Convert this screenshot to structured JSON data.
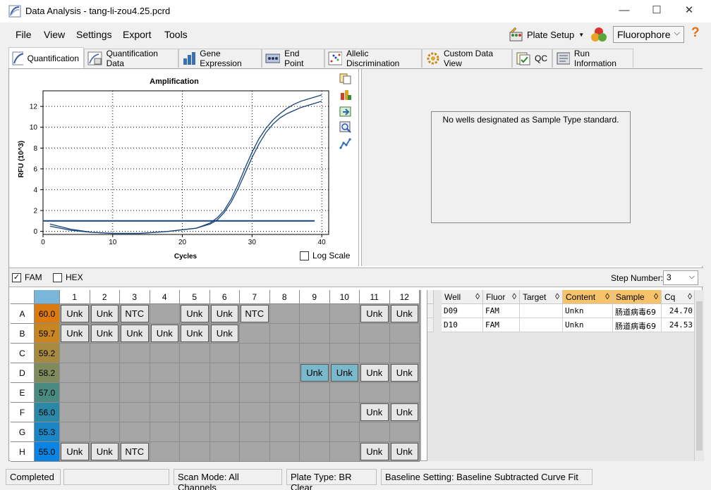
{
  "window": {
    "title": "Data Analysis - tang-li-zou4.25.pcrd",
    "minimize": "—",
    "maximize": "☐",
    "close": "✕"
  },
  "menu": [
    "File",
    "View",
    "Settings",
    "Export",
    "Tools"
  ],
  "toolbar": {
    "plate_setup": "Plate Setup",
    "fluorophore": "Fluorophore",
    "help": "?"
  },
  "tabs": [
    "Quantification",
    "Quantification Data",
    "Gene Expression",
    "End Point",
    "Allelic Discrimination",
    "Custom Data View",
    "QC",
    "Run Information"
  ],
  "chart_data": {
    "type": "line",
    "title": "Amplification",
    "xlabel": "Cycles",
    "ylabel": "RFU (10^3)",
    "xlim": [
      0,
      41
    ],
    "ylim": [
      -0.3,
      13.5
    ],
    "xticks": [
      0,
      10,
      20,
      30,
      40
    ],
    "yticks": [
      0,
      2,
      4,
      6,
      8,
      10,
      12
    ],
    "grid": true,
    "threshold": 1.0,
    "series": [
      {
        "x": [
          1,
          4,
          7,
          10,
          14,
          18,
          22,
          24,
          25,
          26,
          27,
          28,
          29,
          30,
          31,
          32,
          33,
          34,
          35,
          36,
          37,
          38,
          39,
          40
        ],
        "values": [
          0.5,
          0.1,
          -0.1,
          -0.2,
          -0.2,
          0.0,
          0.3,
          0.7,
          1.1,
          1.8,
          2.8,
          4.1,
          5.6,
          7.1,
          8.4,
          9.5,
          10.3,
          10.9,
          11.3,
          11.6,
          11.9,
          12.1,
          12.3,
          12.5
        ]
      },
      {
        "x": [
          1,
          4,
          7,
          10,
          14,
          18,
          22,
          24,
          25,
          26,
          27,
          28,
          29,
          30,
          31,
          32,
          33,
          34,
          35,
          36,
          37,
          38,
          39,
          40
        ],
        "values": [
          0.7,
          0.2,
          -0.1,
          -0.2,
          -0.2,
          0.0,
          0.3,
          0.8,
          1.3,
          2.0,
          3.1,
          4.5,
          6.1,
          7.6,
          8.9,
          9.9,
          10.7,
          11.3,
          11.8,
          12.2,
          12.5,
          12.7,
          12.9,
          13.1
        ]
      }
    ]
  },
  "log_scale": "Log Scale",
  "no_standard": "No wells designated as Sample Type standard.",
  "fluors": [
    "FAM",
    "HEX"
  ],
  "step": {
    "label": "Step Number:",
    "value": "3"
  },
  "plate": {
    "cols": [
      "1",
      "2",
      "3",
      "4",
      "5",
      "6",
      "7",
      "8",
      "9",
      "10",
      "11",
      "12"
    ],
    "rows": [
      {
        "label": "A",
        "temp": "60.0",
        "color": "#dc7a12",
        "wells": [
          "Unk",
          "Unk",
          "NTC",
          "",
          "Unk",
          "Unk",
          "NTC",
          "",
          "",
          "",
          "Unk",
          "Unk"
        ]
      },
      {
        "label": "B",
        "temp": "59.7",
        "color": "#c7861f",
        "wells": [
          "Unk",
          "Unk",
          "Unk",
          "Unk",
          "Unk",
          "Unk",
          "",
          "",
          "",
          "",
          "",
          ""
        ]
      },
      {
        "label": "C",
        "temp": "59.2",
        "color": "#a78a3e",
        "wells": [
          "",
          "",
          "",
          "",
          "",
          "",
          "",
          "",
          "",
          "",
          "",
          ""
        ]
      },
      {
        "label": "D",
        "temp": "58.2",
        "color": "#7f8b5c",
        "wells": [
          "",
          "",
          "",
          "",
          "",
          "",
          "",
          "",
          "Unk",
          "Unk",
          "Unk",
          "Unk"
        ]
      },
      {
        "label": "E",
        "temp": "57.0",
        "color": "#4b8a80",
        "wells": [
          "",
          "",
          "",
          "",
          "",
          "",
          "",
          "",
          "",
          "",
          "",
          ""
        ]
      },
      {
        "label": "F",
        "temp": "56.0",
        "color": "#2c88a7",
        "wells": [
          "",
          "",
          "",
          "",
          "",
          "",
          "",
          "",
          "",
          "",
          "Unk",
          "Unk"
        ]
      },
      {
        "label": "G",
        "temp": "55.3",
        "color": "#1a86c6",
        "wells": [
          "",
          "",
          "",
          "",
          "",
          "",
          "",
          "",
          "",
          "",
          "",
          ""
        ]
      },
      {
        "label": "H",
        "temp": "55.0",
        "color": "#0b83e3",
        "wells": [
          "Unk",
          "Unk",
          "NTC",
          "",
          "",
          "",
          "",
          "",
          "",
          "",
          "Unk",
          "Unk"
        ]
      }
    ]
  },
  "table": {
    "headers": [
      "Well",
      "Fluor",
      "Target",
      "Content",
      "Sample",
      "Cq"
    ],
    "rows": [
      [
        "D09",
        "FAM",
        "",
        "Unkn",
        "肠道病毒69",
        "24.70"
      ],
      [
        "D10",
        "FAM",
        "",
        "Unkn",
        "肠道病毒69",
        "24.53"
      ]
    ]
  },
  "status": [
    "Completed",
    "Scan Mode: All Channels",
    "Plate Type: BR Clear",
    "Baseline Setting: Baseline Subtracted Curve Fit"
  ]
}
